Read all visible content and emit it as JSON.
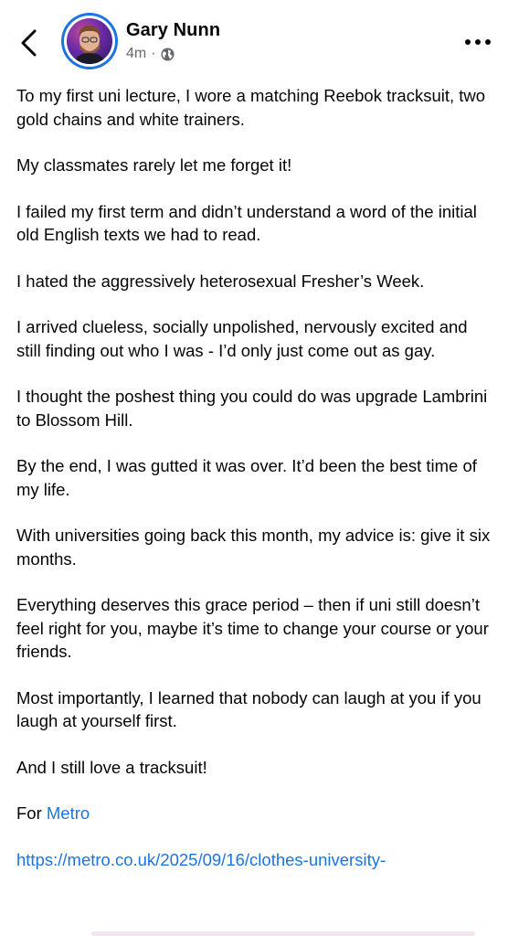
{
  "header": {
    "back_icon": "chevron-left-icon",
    "author_name": "Gary Nunn",
    "time_ago": "4m",
    "separator": "·",
    "audience_icon": "globe-icon",
    "more_icon": "more-horizontal-icon"
  },
  "post": {
    "paragraphs": [
      "To my first uni lecture, I wore a matching Reebok tracksuit, two gold chains and white trainers.",
      "My classmates rarely let me forget it!",
      "I failed my first term and didn’t understand a word of the initial old English texts we had to read.",
      "I hated the aggressively heterosexual Fresher’s Week.",
      "I arrived clueless, socially unpolished, nervously excited and still finding out who I was - I’d only just come out as gay.",
      "I thought the poshest thing you could do was upgrade Lambrini to Blossom Hill.",
      "By the end, I was gutted it was over. It’d been the best time of my life.",
      "With universities going back this month, my advice is: give it six months.",
      "Everything deserves this grace period – then if uni still doesn’t feel right for you, maybe it’s time to change your course or your friends.",
      "Most importantly, I learned that nobody can laugh at you if you laugh at yourself first.",
      "And I still love a tracksuit!"
    ],
    "for_prefix": "For ",
    "for_link": "Metro",
    "url": "https://metro.co.uk/2025/09/16/clothes-university-"
  },
  "colors": {
    "link": "#1b74e4",
    "meta_gray": "#65676b",
    "avatar_ring": "#1b74e4"
  }
}
